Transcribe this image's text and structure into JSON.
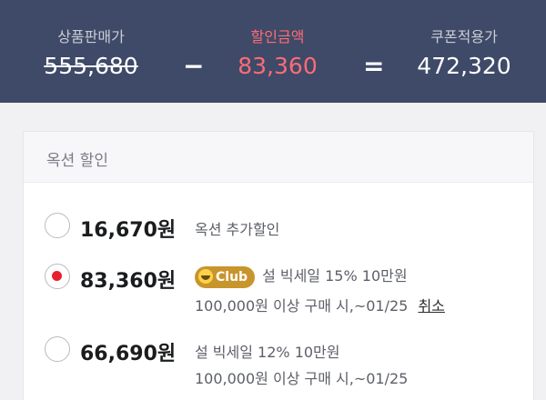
{
  "summary": {
    "original_label": "상품판매가",
    "original_value": "555,680",
    "minus_symbol": "−",
    "discount_label": "할인금액",
    "discount_value": "83,360",
    "equals_symbol": "=",
    "final_label": "쿠폰적용가",
    "final_value": "472,320"
  },
  "section": {
    "title": "옥션 할인"
  },
  "options": [
    {
      "amount": "16,670원",
      "selected": false,
      "line1": "옥션 추가할인",
      "line2": ""
    },
    {
      "amount": "83,360원",
      "selected": true,
      "badge": "Club",
      "line1": "설 빅세일 15% 10만원",
      "line2": "100,000원 이상 구매 시,~01/25",
      "action": "취소"
    },
    {
      "amount": "66,690원",
      "selected": false,
      "line1": "설 빅세일 12% 10만원",
      "line2": "100,000원 이상 구매 시,~01/25"
    }
  ],
  "colors": {
    "header_bg": "#3e4a67",
    "discount": "#ff6b76",
    "radio_selected": "#e8202e",
    "club_badge": "#c8952d"
  }
}
